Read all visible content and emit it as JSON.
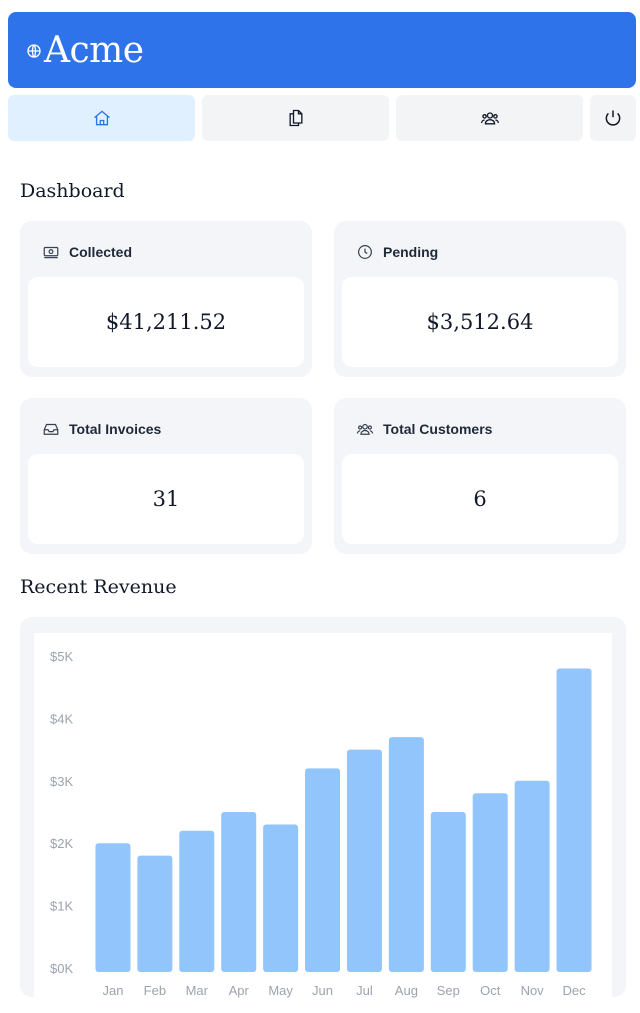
{
  "brand": {
    "name": "Acme",
    "icon": "globe-icon",
    "color": "#2f73ea"
  },
  "nav": {
    "items": [
      {
        "name": "home",
        "icon": "home-icon",
        "active": true
      },
      {
        "name": "invoices",
        "icon": "documents-icon",
        "active": false
      },
      {
        "name": "customers",
        "icon": "user-group-icon",
        "active": false
      }
    ],
    "signout_icon": "power-icon"
  },
  "dashboard": {
    "title": "Dashboard",
    "cards": [
      {
        "label": "Collected",
        "value": "$41,211.52",
        "icon": "banknotes-icon"
      },
      {
        "label": "Pending",
        "value": "$3,512.64",
        "icon": "clock-icon"
      },
      {
        "label": "Total Invoices",
        "value": "31",
        "icon": "inbox-icon"
      },
      {
        "label": "Total Customers",
        "value": "6",
        "icon": "user-group-icon"
      }
    ]
  },
  "revenue": {
    "title": "Recent Revenue",
    "chart_data": {
      "type": "bar",
      "categories": [
        "Jan",
        "Feb",
        "Mar",
        "Apr",
        "May",
        "Jun",
        "Jul",
        "Aug",
        "Sep",
        "Oct",
        "Nov",
        "Dec"
      ],
      "values": [
        2000,
        1800,
        2200,
        2500,
        2300,
        3200,
        3500,
        3700,
        2500,
        2800,
        3000,
        4800
      ],
      "y_ticks": [
        "$5K",
        "$4K",
        "$3K",
        "$2K",
        "$1K",
        "$0K"
      ],
      "ylim": [
        0,
        5000
      ],
      "bar_color": "#93c5fd",
      "grid": false
    }
  }
}
